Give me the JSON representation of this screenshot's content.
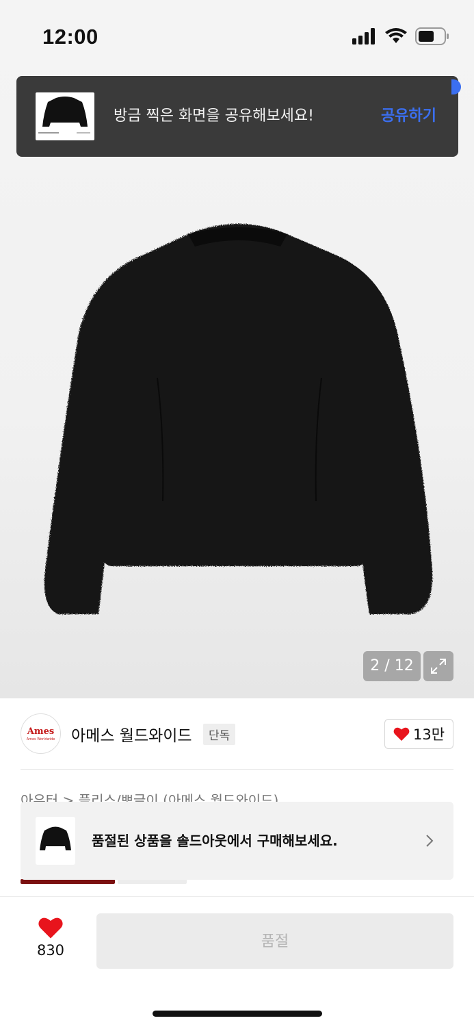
{
  "status_bar": {
    "time": "12:00"
  },
  "toast": {
    "message": "방금 찍은 화면을 공유해보세요!",
    "action": "공유하기"
  },
  "gallery": {
    "counter": "2 / 12"
  },
  "brand": {
    "logo_text": "Ames",
    "logo_subtext": "Ames Worldwide",
    "name": "아메스 월드와이드",
    "tag": "단독"
  },
  "likes": {
    "count": "13만"
  },
  "breadcrumb": "아우터 > 플리스/뽀글이 (아메스 월드와이드)",
  "soldout_banner": {
    "text": "품절된 상품을 솔드아웃에서 구매해보세요."
  },
  "bottom_bar": {
    "wish_count": "830",
    "buy_label": "품절"
  },
  "colors": {
    "accent": "#3b6ff0",
    "heart": "#e8141c",
    "brand_red": "#c41a1a",
    "bar_dark": "#7a0f0f"
  }
}
